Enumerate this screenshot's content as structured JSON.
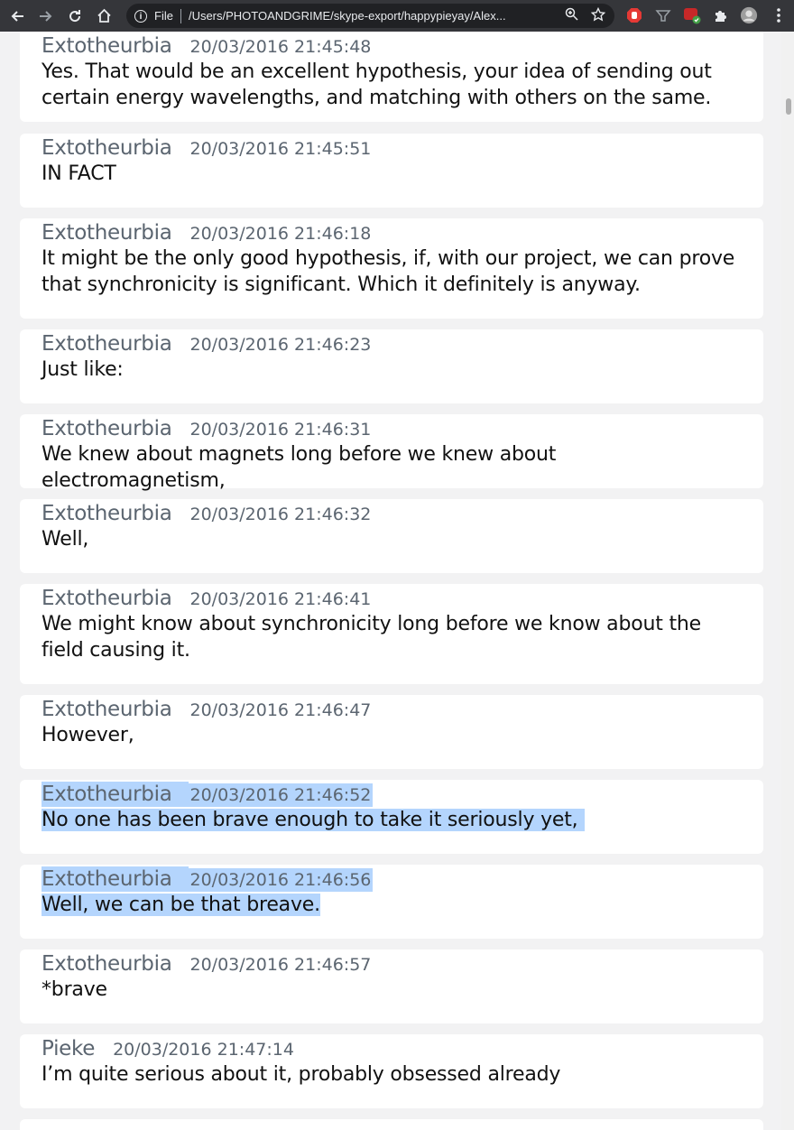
{
  "browser": {
    "file_label": "File",
    "url": "/Users/PHOTOANDGRIME/skype-export/happypieyay/Alex..."
  },
  "messages": [
    {
      "author": "Extotheurbia",
      "time": "20/03/2016 21:45:48",
      "text": "Yes. That would be an excellent hypothesis, your idea of sending out certain energy wavelengths, and matching with others on the same.",
      "selected": false
    },
    {
      "author": "Extotheurbia",
      "time": "20/03/2016 21:45:51",
      "text": "IN FACT",
      "selected": false
    },
    {
      "author": "Extotheurbia",
      "time": "20/03/2016 21:46:18",
      "text": "It might be the only good hypothesis, if, with our project, we can prove that synchronicity is significant. Which it definitely is anyway.",
      "selected": false
    },
    {
      "author": "Extotheurbia",
      "time": "20/03/2016 21:46:23",
      "text": "Just like:",
      "selected": false
    },
    {
      "author": "Extotheurbia",
      "time": "20/03/2016 21:46:31",
      "text": "We knew about magnets long before we knew about electromagnetism,",
      "selected": false
    },
    {
      "author": "Extotheurbia",
      "time": "20/03/2016 21:46:32",
      "text": "Well,",
      "selected": false
    },
    {
      "author": "Extotheurbia",
      "time": "20/03/2016 21:46:41",
      "text": "We might know about synchronicity long before we know about the field causing it.",
      "selected": false
    },
    {
      "author": "Extotheurbia",
      "time": "20/03/2016 21:46:47",
      "text": "However,",
      "selected": false
    },
    {
      "author": "Extotheurbia",
      "time": "20/03/2016 21:46:52",
      "text": "No one has been brave enough to take it seriously yet,",
      "selected": true
    },
    {
      "author": "Extotheurbia",
      "time": "20/03/2016 21:46:56",
      "text": "Well, we can be that breave.",
      "selected": true
    },
    {
      "author": "Extotheurbia",
      "time": "20/03/2016 21:46:57",
      "text": "*brave",
      "selected": false
    },
    {
      "author": "Pieke",
      "time": "20/03/2016 21:47:14",
      "text": "I’m quite serious about it, probably obsessed already",
      "selected": false
    }
  ]
}
